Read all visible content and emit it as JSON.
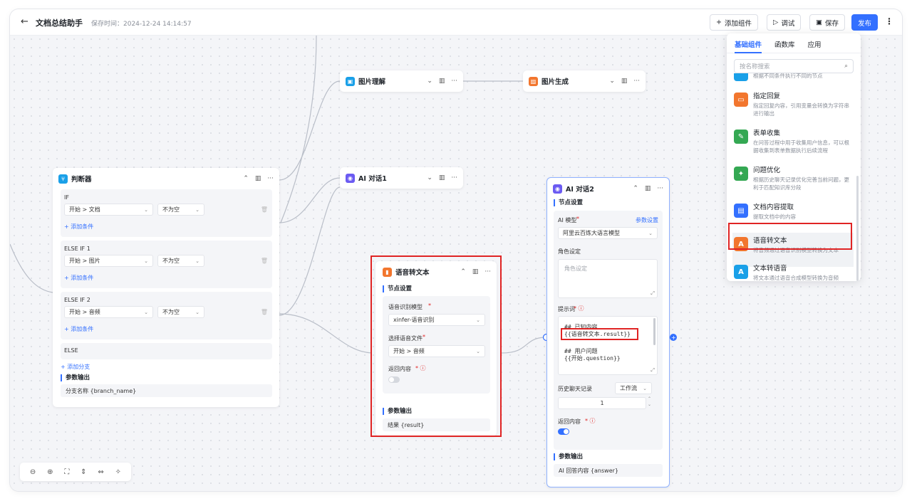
{
  "header": {
    "back_icon": "arrow-left-icon",
    "title": "文档总结助手",
    "save_time": "保存时间：2024-12-24 14:14:57",
    "add_component": "添加组件",
    "debug": "调试",
    "save": "保存",
    "publish": "发布"
  },
  "nodes": {
    "image_understand": {
      "title": "图片理解"
    },
    "image_generate": {
      "title": "图片生成"
    },
    "ai_chat1": {
      "title": "AI 对话1"
    },
    "judge": {
      "title": "判断器",
      "branches": [
        {
          "label": "IF",
          "field": "开始 > 文档",
          "op": "不为空",
          "add": "+ 添加条件"
        },
        {
          "label": "ELSE IF 1",
          "field": "开始 > 图片",
          "op": "不为空",
          "add": "+ 添加条件"
        },
        {
          "label": "ELSE IF 2",
          "field": "开始 > 音频",
          "op": "不为空",
          "add": "+ 添加条件"
        },
        {
          "label": "ELSE"
        }
      ],
      "add_branch": "+ 添加分支",
      "output_title": "参数输出",
      "output": "分支名称 {branch_name}"
    },
    "stt": {
      "title": "语音转文本",
      "settings": "节点设置",
      "model_label": "语音识别模型",
      "model": "xinfer-语音识别",
      "file_label": "选择语音文件",
      "file": "开始 > 音频",
      "return_label": "返回内容",
      "output_title": "参数输出",
      "output": "结果 {result}"
    },
    "ai_chat2": {
      "title": "AI 对话2",
      "settings": "节点设置",
      "model_label": "AI 模型",
      "param_settings": "参数设置",
      "model": "阿里云百炼大语言模型",
      "role_label": "角色设定",
      "role_placeholder": "角色设定",
      "prompt_label": "提示词",
      "prompt_line1": "## 已知内容",
      "prompt_line2": "{{语音转文本.result}}",
      "prompt_line3": "## 用户问题",
      "prompt_line4": "{{开始.question}}",
      "history_label": "历史聊天记录",
      "history_mode": "工作流",
      "history_count": "1",
      "return_label": "返回内容",
      "output_title": "参数输出",
      "output": "AI 回答内容 {answer}"
    }
  },
  "drawer": {
    "tabs": [
      "基础组件",
      "函数库",
      "应用"
    ],
    "search_placeholder": "按名称搜索",
    "partial_item": "根据不同条件执行不同的节点",
    "items": [
      {
        "name": "指定回复",
        "desc": "指定回复内容，引用变量会转换为字符串进行输出",
        "icon": "reply-icon",
        "color": "#f2762e"
      },
      {
        "name": "表单收集",
        "desc": "在问答过程中用于收集用户信息，可以根据收集到表单数据执行后续流程",
        "icon": "form-icon",
        "color": "#34a853"
      },
      {
        "name": "问题优化",
        "desc": "根据历史聊天记录优化完善当前问题，更利于匹配知识库分段",
        "icon": "optimize-icon",
        "color": "#34a853"
      },
      {
        "name": "文档内容提取",
        "desc": "提取文档中的内容",
        "icon": "document-icon",
        "color": "#3370ff"
      },
      {
        "name": "语音转文本",
        "desc": "将音频通过语音识别模型转换为文本",
        "icon": "speech-to-text-icon",
        "color": "#f2762e"
      },
      {
        "name": "文本转语音",
        "desc": "将文本通过语音合成模型转换为音频",
        "icon": "text-to-speech-icon",
        "color": "#1aa0e8"
      }
    ]
  },
  "colors": {
    "accent": "#3370ff",
    "highlight": "#e02424"
  }
}
